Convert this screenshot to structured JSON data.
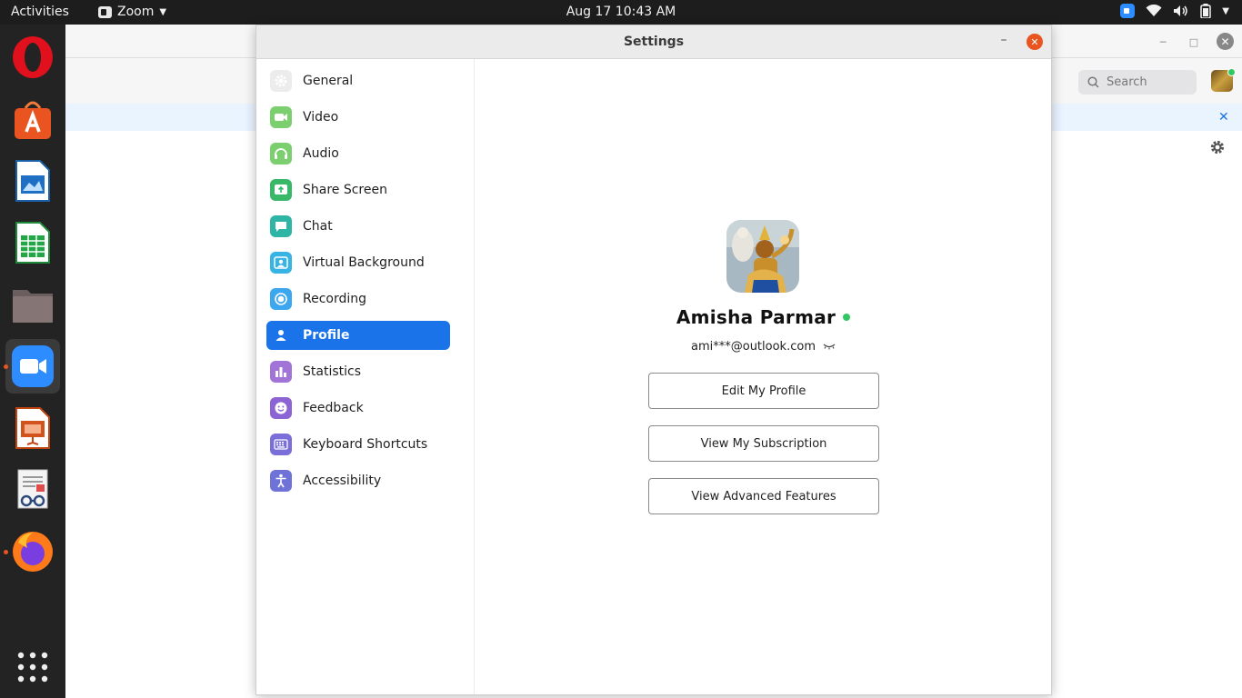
{
  "topbar": {
    "activities": "Activities",
    "app_name": "Zoom",
    "clock": "Aug 17  10:43 AM"
  },
  "dock": {
    "items": [
      "opera-browser",
      "ubuntu-software",
      "libreoffice-writer",
      "libreoffice-calc",
      "files",
      "zoom",
      "libreoffice-impress",
      "document-viewer",
      "firefox",
      "show-applications"
    ],
    "active": "zoom"
  },
  "background_window": {
    "search_placeholder": "Search"
  },
  "settings": {
    "title": "Settings",
    "nav": [
      {
        "label": "General",
        "icon": "gear-icon",
        "color": "#e6e6e6"
      },
      {
        "label": "Video",
        "icon": "video-camera-icon",
        "color": "#7ccf6e"
      },
      {
        "label": "Audio",
        "icon": "headphones-icon",
        "color": "#7ccf6e"
      },
      {
        "label": "Share Screen",
        "icon": "share-screen-icon",
        "color": "#39b86a"
      },
      {
        "label": "Chat",
        "icon": "chat-bubble-icon",
        "color": "#2eb5a6"
      },
      {
        "label": "Virtual Background",
        "icon": "virtual-background-icon",
        "color": "#37b3e4"
      },
      {
        "label": "Recording",
        "icon": "record-icon",
        "color": "#3ca7ef"
      },
      {
        "label": "Profile",
        "icon": "person-icon",
        "color": "#1a73e8"
      },
      {
        "label": "Statistics",
        "icon": "bar-chart-icon",
        "color": "#a274d8"
      },
      {
        "label": "Feedback",
        "icon": "smiley-icon",
        "color": "#8d64d4"
      },
      {
        "label": "Keyboard Shortcuts",
        "icon": "keyboard-icon",
        "color": "#7a6ed8"
      },
      {
        "label": "Accessibility",
        "icon": "accessibility-icon",
        "color": "#6f72d6"
      }
    ],
    "selected": "Profile",
    "profile": {
      "name": "Amisha Parmar",
      "status": "online",
      "email": "ami***@outlook.com",
      "buttons": {
        "edit": "Edit My Profile",
        "subscription": "View My Subscription",
        "advanced": "View Advanced Features"
      }
    }
  }
}
